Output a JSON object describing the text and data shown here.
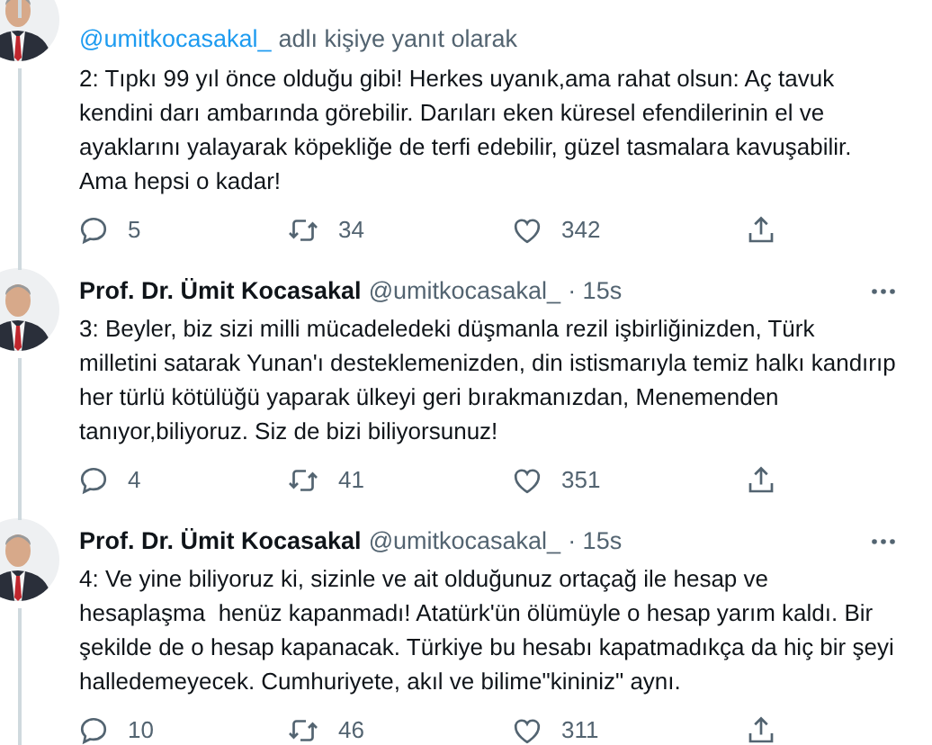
{
  "tweets": [
    {
      "reply_to": "@umitkocasakal_",
      "reply_label": "adlı kişiye yanıt olarak",
      "text": "2: Tıpkı 99 yıl önce olduğu gibi! Herkes uyanık,ama rahat olsun: Aç tavuk kendini darı ambarında görebilir. Darıları eken küresel efendilerinin el ve ayaklarını yalayarak köpekliğe de terfi edebilir, güzel tasmalara kavuşabilir. Ama hepsi o kadar!",
      "replies": "5",
      "retweets": "34",
      "likes": "342"
    },
    {
      "author": "Prof. Dr. Ümit Kocasakal",
      "handle": "@umitkocasakal_",
      "time": "· 15s",
      "text": "3: Beyler, biz sizi milli mücadeledeki düşmanla rezil işbirliğinizden, Türk milletini satarak Yunan'ı desteklemenizden, din istismarıyla temiz halkı kandırıp her türlü kötülüğü yaparak ülkeyi geri bırakmanızdan, Menemenden tanıyor,biliyoruz. Siz de bizi biliyorsunuz!",
      "replies": "4",
      "retweets": "41",
      "likes": "351"
    },
    {
      "author": "Prof. Dr. Ümit Kocasakal",
      "handle": "@umitkocasakal_",
      "time": "· 15s",
      "text": "4: Ve yine biliyoruz ki, sizinle ve ait olduğunuz ortaçağ ile hesap ve hesaplaşma  henüz kapanmadı! Atatürk'ün ölümüyle o hesap yarım kaldı. Bir şekilde de o hesap kapanacak. Türkiye bu hesabı kapatmadıkça da hiç bir şeyi halledemeyecek. Cumhuriyete, akıl ve bilime\"kininiz\" aynı.",
      "replies": "10",
      "retweets": "46",
      "likes": "311"
    }
  ]
}
